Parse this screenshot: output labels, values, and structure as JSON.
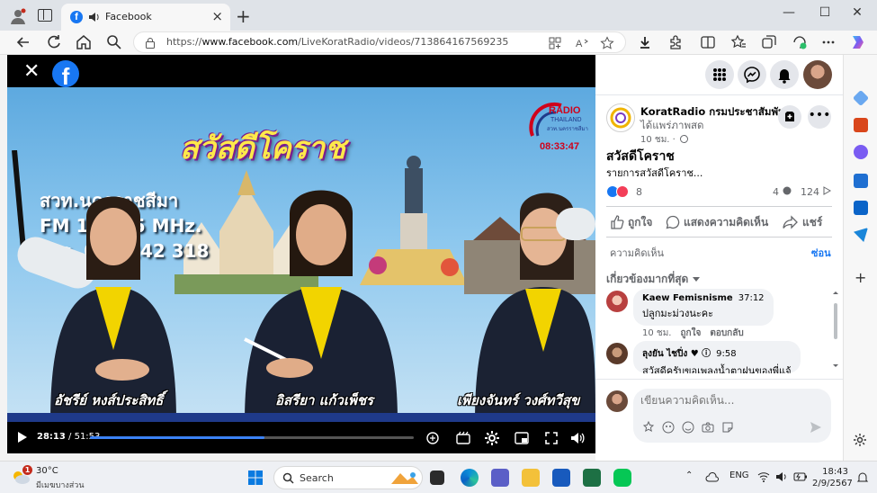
{
  "browser": {
    "tab_title": "Facebook",
    "url_prefix": "https://",
    "url_host": "www.facebook.com",
    "url_path": "/LiveKoratRadio/videos/713864167569235",
    "icons": [
      "profile-icon",
      "tabs-icon",
      "facebook-icon",
      "speaker-icon",
      "close-icon",
      "plus-icon",
      "back-icon",
      "refresh-icon",
      "home-icon",
      "search-icon",
      "lock-icon",
      "apps-icon",
      "read-aloud-icon",
      "favorite-icon",
      "download-icon",
      "extensions-icon",
      "split-screen-icon",
      "favorites-icon",
      "collections-icon",
      "browser-essentials-icon",
      "more-icon",
      "copilot-icon"
    ]
  },
  "video": {
    "show_title": "สวัสดีโคราช",
    "station_line1": "สวท.นครราชสีมา",
    "station_line2": "FM 104.25 MHz.",
    "station_line3": "โทร. 044 242 318",
    "radio_logo_text": "RADIO",
    "radio_logo_sub": "THAILAND",
    "radio_logo_station": "สวท.นครราชสีมา",
    "clock": "08:33:47",
    "presenters": [
      "อัชรีย์ หงส์ประสิทธิ์",
      "อิสรียา แก้วเพ็ชร",
      "เพียงจันทร์ วงศ์ทวีสุข"
    ],
    "time_current": "28:13",
    "time_sep": " / ",
    "time_total": "51:53",
    "progress": 0.54
  },
  "post": {
    "page_name": "KoratRadio กรมประชาสัมพันธ์",
    "live_text": "ได้แพร่ภาพสด",
    "time": "10 ชม.",
    "title": "สวัสดีโคราช",
    "description": "รายการสวัสดีโคราช...",
    "reaction_count": "8",
    "comment_count": "4",
    "view_count": "124",
    "actions": {
      "like": "ถูกใจ",
      "comment": "แสดงความคิดเห็น",
      "share": "แชร์"
    },
    "comments_label": "ความคิดเห็น",
    "hide_label": "ซ่อน",
    "sort_label": "เกี่ยวข้องมากที่สุด"
  },
  "comments": [
    {
      "name": "Kaew Femisnisme",
      "timestamp": "37:12",
      "text": "ปลูกมะม่วงนะคะ",
      "age": "10 ชม.",
      "like": "ถูกใจ",
      "reply": "ตอบกลับ"
    },
    {
      "name": "ลุงยัน ไชปิ่ง",
      "timestamp": "9:58",
      "text": "สวัสดีครับขอเพลงน้ำตาฝนของพี่แจ้"
    }
  ],
  "comment_input": {
    "placeholder": "เขียนความคิดเห็น..."
  },
  "taskbar": {
    "temperature": "30°C",
    "condition": "มีเมฆบางส่วน",
    "weather_badge": "1",
    "search_label": "Search",
    "lang": "ENG",
    "time": "18:43",
    "date": "2/9/2567"
  },
  "colors": {
    "facebook_blue": "#1877f2",
    "love_red": "#f33e58",
    "show_yellow": "#fde94a",
    "banner_blue": "#1f3a8a"
  }
}
